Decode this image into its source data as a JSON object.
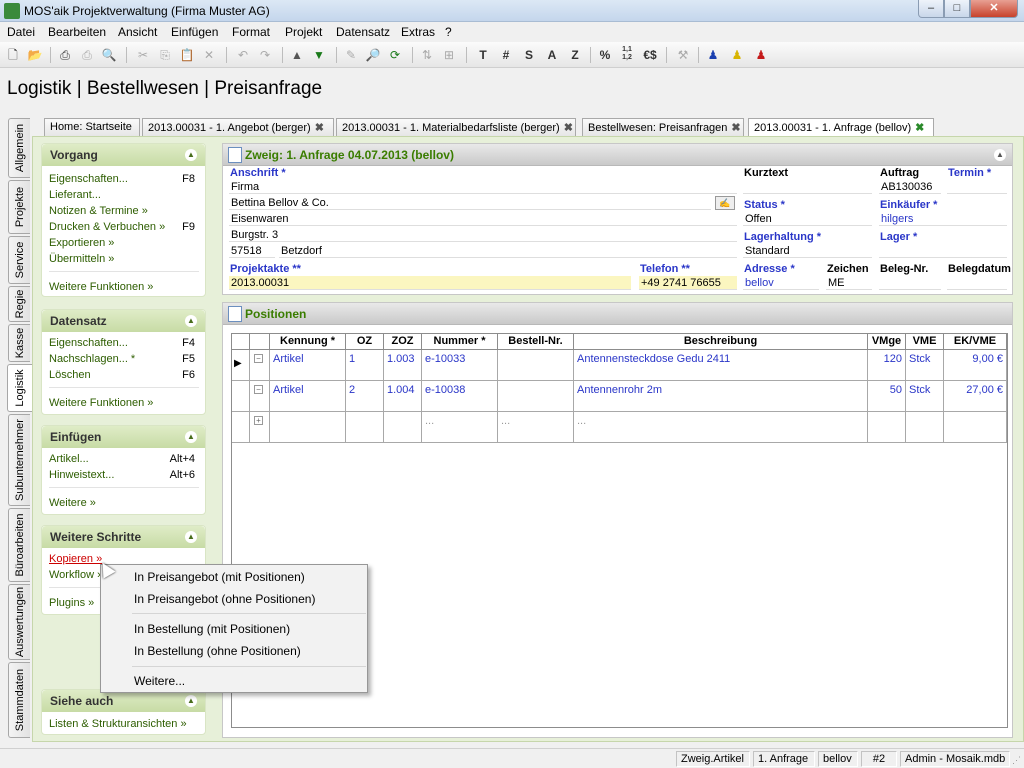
{
  "window": {
    "title": "MOS'aik Projektverwaltung (Firma Muster AG)",
    "min": "–",
    "max": "□",
    "close": "✕"
  },
  "menu": [
    "Datei",
    "Bearbeiten",
    "Ansicht",
    "Einfügen",
    "Format",
    "Projekt",
    "Datensatz",
    "Extras",
    "?"
  ],
  "toolbar": {
    "t": "T",
    "hash": "#",
    "s": "S",
    "a": "A",
    "z": "Z",
    "pct": "%",
    "num": "1,1 1,2",
    "euro": "€$"
  },
  "page_title": "Logistik | Bestellwesen | Preisanfrage",
  "vtabs": [
    "Allgemein",
    "Projekte",
    "Service",
    "Regie",
    "Kasse",
    "Logistik",
    "Subunternehmer",
    "Büroarbeiten",
    "Auswertungen",
    "Stammdaten"
  ],
  "doc_tabs": [
    {
      "label": "Home: Startseite"
    },
    {
      "label": "2013.00031 - 1. Angebot (berger)"
    },
    {
      "label": "2013.00031 - 1. Materialbedarfsliste (berger)"
    },
    {
      "label": "Bestellwesen: Preisanfragen"
    },
    {
      "label": "2013.00031 - 1. Anfrage (bellov)"
    }
  ],
  "taskpane": {
    "vorgang": {
      "title": "Vorgang",
      "items": [
        {
          "label": "Eigenschaften...",
          "key": "F8"
        },
        {
          "label": "Lieferant...",
          "key": ""
        },
        {
          "label": "Notizen & Termine »",
          "key": ""
        },
        {
          "label": "Drucken & Verbuchen »",
          "key": "F9"
        },
        {
          "label": "Exportieren »",
          "key": ""
        },
        {
          "label": "Übermitteln »",
          "key": ""
        }
      ],
      "more": "Weitere Funktionen »"
    },
    "datensatz": {
      "title": "Datensatz",
      "items": [
        {
          "label": "Eigenschaften...",
          "key": "F4"
        },
        {
          "label": "Nachschlagen... *",
          "key": "F5"
        },
        {
          "label": "Löschen",
          "key": "F6"
        }
      ],
      "more": "Weitere Funktionen »"
    },
    "einfuegen": {
      "title": "Einfügen",
      "items": [
        {
          "label": "Artikel...",
          "key": "Alt+4"
        },
        {
          "label": "Hinweistext...",
          "key": "Alt+6"
        }
      ],
      "more": "Weitere »"
    },
    "schritte": {
      "title": "Weitere Schritte",
      "items": [
        {
          "label": "Kopieren »"
        },
        {
          "label": "Workflow »"
        }
      ],
      "more": "Plugins »"
    },
    "siehe": {
      "title": "Siehe auch",
      "items": [
        {
          "label": "Listen & Strukturansichten »"
        }
      ]
    }
  },
  "header": {
    "title": "Zweig: 1. Anfrage 04.07.2013 (bellov)",
    "anschrift_label": "Anschrift *",
    "anschrift": [
      "Firma",
      "Bettina Bellov & Co.",
      "Eisenwaren",
      "Burgstr. 3"
    ],
    "plz": "57518",
    "ort": "Betzdorf",
    "kurztext_label": "Kurztext",
    "kurztext": "",
    "auftrag_label": "Auftrag",
    "auftrag": "AB130036",
    "termin_label": "Termin *",
    "termin": "",
    "status_label": "Status *",
    "status": "Offen",
    "einkaeufer_label": "Einkäufer *",
    "einkaeufer": "hilgers",
    "lagerhaltung_label": "Lagerhaltung *",
    "lagerhaltung": "Standard",
    "lager_label": "Lager *",
    "lager": "",
    "projektakte_label": "Projektakte **",
    "projektakte": "2013.00031",
    "telefon_label": "Telefon **",
    "telefon": "+49 2741 76655",
    "adresse_label": "Adresse *",
    "adresse": "bellov",
    "zeichen_label": "Zeichen",
    "zeichen": "ME",
    "belegnr_label": "Beleg-Nr.",
    "belegnr": "",
    "belegdatum_label": "Belegdatum",
    "belegdatum": ""
  },
  "positions": {
    "title": "Positionen",
    "columns": [
      "Kennung *",
      "OZ",
      "ZOZ",
      "Nummer *",
      "Bestell-Nr.",
      "Beschreibung",
      "VMge",
      "VME",
      "EK/VME"
    ],
    "rows": [
      {
        "kennung": "Artikel",
        "oz": "1",
        "zoz": "1.003",
        "nummer": "e-10033",
        "bestellnr": "",
        "beschreibung": "Antennensteckdose Gedu 2411",
        "vmge": "120",
        "vme": "Stck",
        "ek": "9,00 €"
      },
      {
        "kennung": "Artikel",
        "oz": "2",
        "zoz": "1.004",
        "nummer": "e-10038",
        "bestellnr": "",
        "beschreibung": "Antennenrohr 2m",
        "vmge": "50",
        "vme": "Stck",
        "ek": "27,00 €"
      }
    ],
    "new_row": {
      "nummer": "...",
      "bestellnr": "...",
      "beschreibung": "..."
    }
  },
  "context_menu": [
    "In Preisangebot (mit Positionen)",
    "In Preisangebot (ohne Positionen)",
    "In Bestellung (mit Positionen)",
    "In Bestellung (ohne Positionen)",
    "Weitere..."
  ],
  "statusbar": [
    "Zweig.Artikel",
    "1. Anfrage",
    "bellov",
    "#2",
    "Admin - Mosaik.mdb"
  ]
}
